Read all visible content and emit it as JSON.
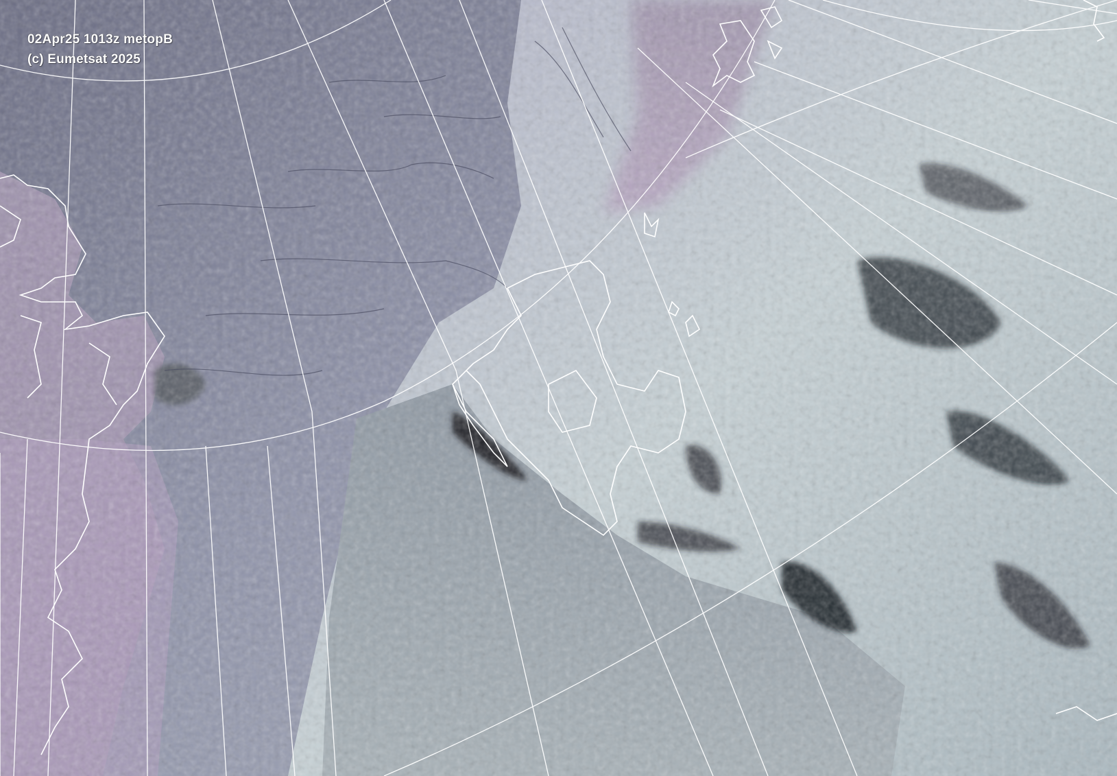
{
  "image": {
    "caption_line1": "02Apr25 1013z metopB",
    "caption_line2": "(c) Eumetsat 2025"
  },
  "colors": {
    "sea_ice": "#8f93aa",
    "cloud": "#c9d4d8",
    "open_sea": "#5f6d78",
    "dark_water": "#1b1f25",
    "graticule": "#ffffff",
    "coastline": "#ffffff"
  }
}
